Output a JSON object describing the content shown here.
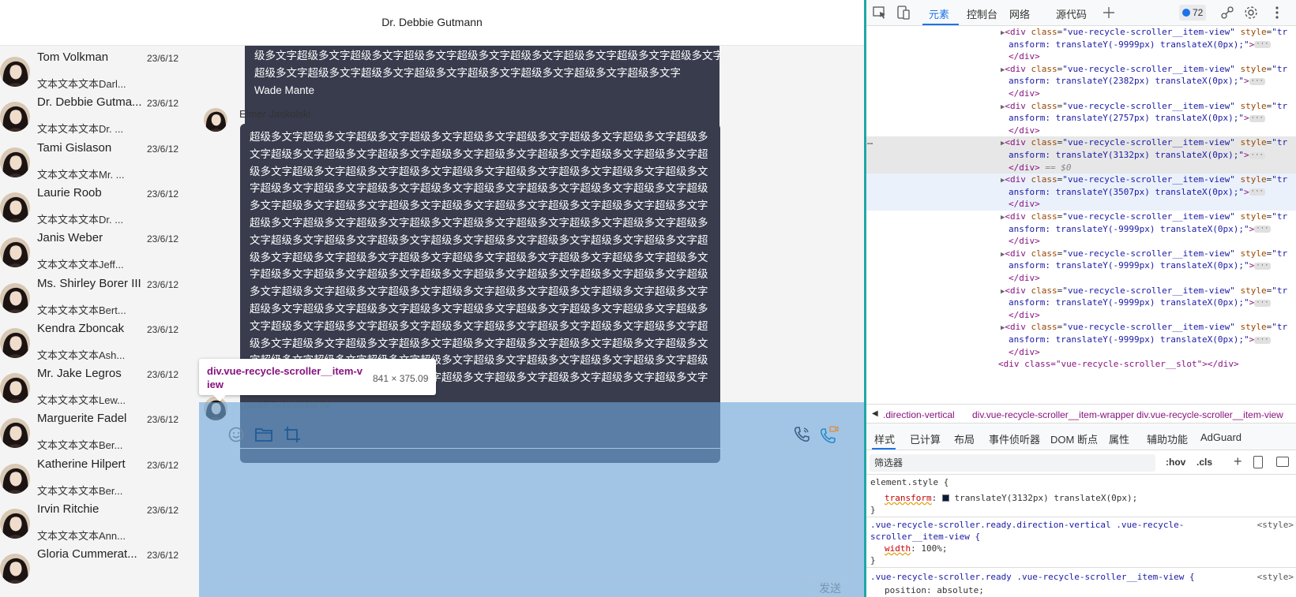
{
  "app": {
    "title": "Dr. Debbie Gutmann",
    "contacts": [
      {
        "name": "Tom Volkman",
        "date": "23/6/12",
        "preview": "文本文本文本Darl..."
      },
      {
        "name": "Dr. Debbie Gutma...",
        "date": "23/6/12",
        "preview": "文本文本文本Dr. ..."
      },
      {
        "name": "Tami Gislason",
        "date": "23/6/12",
        "preview": "文本文本文本Mr. ..."
      },
      {
        "name": "Laurie Roob",
        "date": "23/6/12",
        "preview": "文本文本文本Dr. ..."
      },
      {
        "name": "Janis Weber",
        "date": "23/6/12",
        "preview": "文本文本文本Jeff..."
      },
      {
        "name": "Ms. Shirley Borer III",
        "date": "23/6/12",
        "preview": "文本文本文本Bert..."
      },
      {
        "name": "Kendra Zboncak",
        "date": "23/6/12",
        "preview": "文本文本文本Ash..."
      },
      {
        "name": "Mr. Jake Legros",
        "date": "23/6/12",
        "preview": "文本文本文本Lew..."
      },
      {
        "name": "Marguerite Fadel",
        "date": "23/6/12",
        "preview": "文本文本文本Ber..."
      },
      {
        "name": "Katherine Hilpert",
        "date": "23/6/12",
        "preview": "文本文本文本Ber..."
      },
      {
        "name": "Irvin Ritchie",
        "date": "23/6/12",
        "preview": "文本文本文本Ann..."
      },
      {
        "name": "Gloria Cummerat...",
        "date": "23/6/12",
        "preview": ""
      }
    ],
    "messages": {
      "top_bubble_lines": [
        "级多文字超级多文字超级多文字超级多文字超级多文字超级多文字超级多文字超级多文字超级多文字超级多文字",
        "超级多文字超级多文字超级多文字超级多文字超级多文字超级多文字超级多文字超级多文字",
        "Wade Mante"
      ],
      "main_sender": "Elmer Jaskolski",
      "main_bubble_lines": [
        "超级多文字超级多文字超级多文字超级多文字超级多文字超级多文字超级多文字超级多文字超级多",
        "文字超级多文字超级多文字超级多文字超级多文字超级多文字超级多文字超级多文字超级多文字超",
        "级多文字超级多文字超级多文字超级多文字超级多文字超级多文字超级多文字超级多文字超级多文",
        "字超级多文字超级多文字超级多文字超级多文字超级多文字超级多文字超级多文字超级多文字超级",
        "多文字超级多文字超级多文字超级多文字超级多文字超级多文字超级多文字超级多文字超级多文字",
        "超级多文字超级多文字超级多文字超级多文字超级多文字超级多文字超级多文字超级多文字超级多",
        "文字超级多文字超级多文字超级多文字超级多文字超级多文字超级多文字超级多文字超级多文字超",
        "级多文字超级多文字超级多文字超级多文字超级多文字超级多文字超级多文字超级多文字超级多文",
        "字超级多文字超级多文字超级多文字超级多文字超级多文字超级多文字超级多文字超级多文字超级",
        "多文字超级多文字超级多文字超级多文字超级多文字超级多文字超级多文字超级多文字超级多文字",
        "超级多文字超级多文字超级多文字超级多文字超级多文字超级多文字超级多文字超级多文字超级多",
        "文字超级多文字超级多文字超级多文字超级多文字超级多文字超级多文字超级多文字超级多文字超",
        "级多文字超级多文字超级多文字超级多文字超级多文字超级多文字超级多文字超级多文字超级多文",
        "字超级多文字超级多文字超级多文字超级多文字超级多文字超级多文字超级多文字超级多文字超级",
        "多文字超级多文字超级多文字超级多文字超级多文字超级多文字超级多文字超级多文字超级多文字"
      ],
      "third_sender": "Lowell Schneider IV"
    },
    "tooltip": {
      "selector": "div.vue-recycle-scroller__item-view",
      "size": "841 × 375.09"
    },
    "send_label": "发送"
  },
  "devtools": {
    "tabs": [
      "元素",
      "控制台",
      "网络",
      "源代码"
    ],
    "active_tab": "元素",
    "issues_count": "72",
    "dom_lines": [
      {
        "t": "open",
        "transform": "translateY(-9999px) translateX(0px);"
      },
      {
        "t": "open",
        "transform": "translateY(2382px) translateX(0px);"
      },
      {
        "t": "open",
        "transform": "translateY(2757px) translateX(0px);"
      },
      {
        "t": "open",
        "transform": "translateY(3132px) translateX(0px);",
        "selected": true
      },
      {
        "t": "open",
        "transform": "translateY(3507px) translateX(0px);",
        "hovered": true
      },
      {
        "t": "open",
        "transform": "translateY(-9999px) translateX(0px);"
      },
      {
        "t": "open",
        "transform": "translateY(-9999px) translateX(0px);"
      },
      {
        "t": "open",
        "transform": "translateY(-9999px) translateX(0px);"
      },
      {
        "t": "open",
        "transform": "translateY(-9999px) translateX(0px);"
      }
    ],
    "dom_slot_line": "<div class=\"vue-recycle-scroller__slot\"></div>",
    "selected_marker": "== $0",
    "breadcrumbs": [
      ".direction-vertical",
      "div.vue-recycle-scroller__item-wrapper",
      "div.vue-recycle-scroller__item-view"
    ],
    "subtabs": [
      "样式",
      "已计算",
      "布局",
      "事件侦听器",
      "DOM 断点",
      "属性",
      "辅助功能",
      "AdGuard"
    ],
    "filter_placeholder": "筛选器",
    "filter_hov": ":hov",
    "filter_cls": ".cls",
    "styles": {
      "element_style": "element.style {",
      "transform_prop": "transform",
      "transform_value": "translateY(3132px) translateX(0px);",
      "rule2_selector": ".vue-recycle-scroller.ready.direction-vertical .vue-recycle-",
      "rule2_selector2": "scroller__item-view {",
      "rule2_prop": "width",
      "rule2_value": "100%;",
      "rule3_selector": ".vue-recycle-scroller.ready .vue-recycle-scroller__item-view {",
      "rule3_prop": "position",
      "rule3_value": "absolute;",
      "source": "<style>"
    }
  }
}
